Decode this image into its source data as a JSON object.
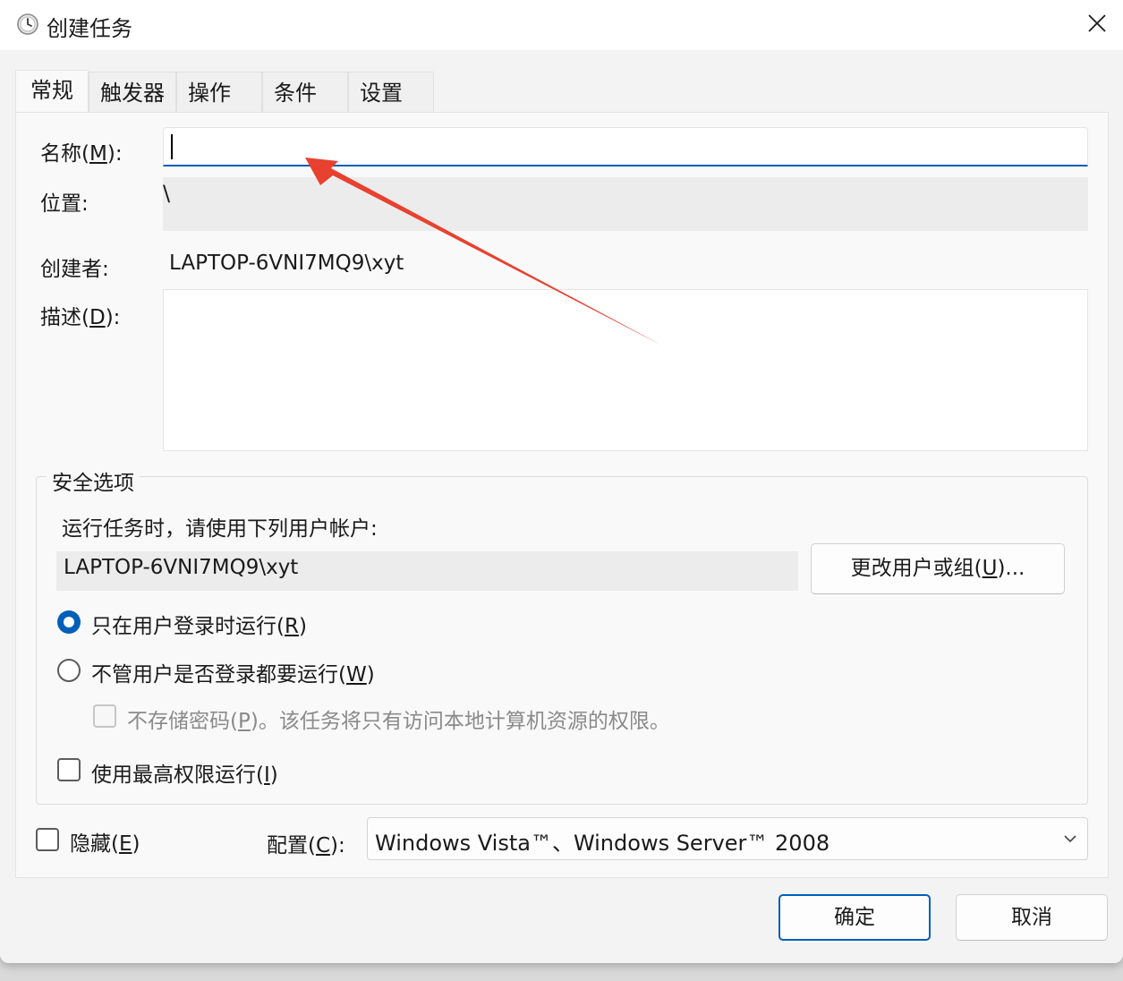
{
  "window": {
    "title": "创建任务",
    "title_icon": "clock-icon",
    "close_icon": "close-icon"
  },
  "tabs": [
    {
      "label": "常规",
      "active": true
    },
    {
      "label": "触发器",
      "active": false
    },
    {
      "label": "操作",
      "active": false
    },
    {
      "label": "条件",
      "active": false
    },
    {
      "label": "设置",
      "active": false
    }
  ],
  "general": {
    "name_label_prefix": "名称(",
    "name_label_key": "M",
    "name_label_suffix": "):",
    "name_value": "",
    "location_label": "位置:",
    "location_value": "\\",
    "creator_label": "创建者:",
    "creator_value": "LAPTOP-6VNI7MQ9\\xyt",
    "desc_label_prefix": "描述(",
    "desc_label_key": "D",
    "desc_label_suffix": "):",
    "desc_value": ""
  },
  "security": {
    "title": "安全选项",
    "run_as_label": "运行任务时，请使用下列用户帐户:",
    "account": "LAPTOP-6VNI7MQ9\\xyt",
    "change_button_prefix": "更改用户或组(",
    "change_button_key": "U",
    "change_button_suffix": ")...",
    "radio_logged_on_prefix": "只在用户登录时运行(",
    "radio_logged_on_key": "R",
    "radio_logged_on_suffix": ")",
    "radio_logged_on_checked": true,
    "radio_whether_prefix": "不管用户是否登录都要运行(",
    "radio_whether_key": "W",
    "radio_whether_suffix": ")",
    "radio_whether_checked": false,
    "no_store_pw_prefix": "不存储密码(",
    "no_store_pw_key": "P",
    "no_store_pw_suffix": ")。该任务将只有访问本地计算机资源的权限。",
    "no_store_pw_checked": false,
    "no_store_pw_enabled": false,
    "highest_priv_prefix": "使用最高权限运行(",
    "highest_priv_key": "I",
    "highest_priv_suffix": ")",
    "highest_priv_checked": false
  },
  "bottom": {
    "hidden_prefix": "隐藏(",
    "hidden_key": "E",
    "hidden_suffix": ")",
    "hidden_checked": false,
    "config_prefix": "配置(",
    "config_key": "C",
    "config_suffix": "):",
    "config_value": "Windows Vista™、Windows Server™ 2008",
    "config_arrow_icon": "chevron-down-icon"
  },
  "buttons": {
    "ok": "确定",
    "cancel": "取消"
  },
  "annotation": {
    "type": "red-arrow",
    "color": "#e8412f"
  },
  "colors": {
    "accent": "#005fb8"
  }
}
